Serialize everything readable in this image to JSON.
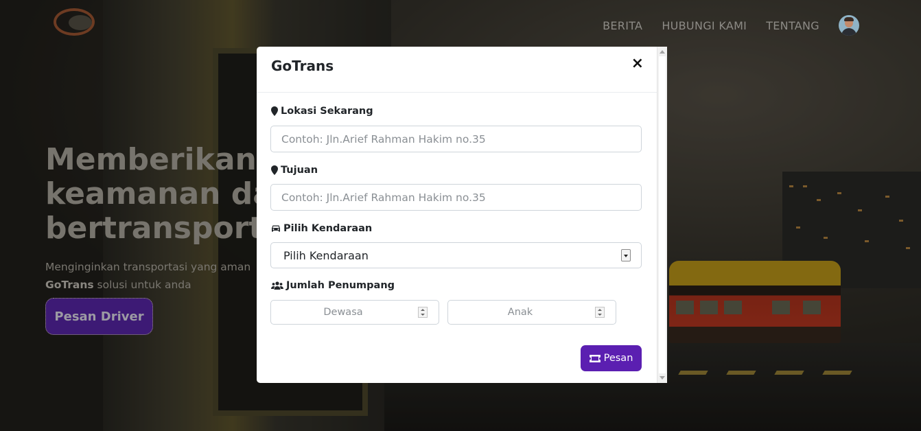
{
  "navbar": {
    "links": [
      "BERITA",
      "HUBUNGI KAMI",
      "TENTANG"
    ]
  },
  "hero": {
    "headline_lines": [
      "Memberikan la",
      "keamanan dan",
      "bertransportas"
    ],
    "subtitle_line1": "Menginginkan transportasi yang aman",
    "subtitle_brand": "GoTrans",
    "subtitle_line2_rest": " solusi untuk anda",
    "cta_label": "Pesan Driver"
  },
  "modal": {
    "title": "GoTrans",
    "close_glyph": "×",
    "lokasi": {
      "label": "Lokasi Sekarang",
      "placeholder": "Contoh: Jln.Arief Rahman Hakim no.35"
    },
    "tujuan": {
      "label": "Tujuan",
      "placeholder": "Contoh: Jln.Arief Rahman Hakim no.35"
    },
    "kendaraan": {
      "label": "Pilih Kendaraan",
      "selected": "Pilih Kendaraan"
    },
    "penumpang": {
      "label": "Jumlah Penumpang",
      "dewasa_placeholder": "Dewasa",
      "anak_placeholder": "Anak"
    },
    "submit_label": "Pesan"
  },
  "icons": {
    "label_location": "map-marker-icon",
    "label_vehicle": "car-icon",
    "label_people": "users-icon",
    "submit": "ticket-icon"
  },
  "colors": {
    "brand_purple": "#5b1fb1",
    "cta_purple": "#3d1a75"
  }
}
